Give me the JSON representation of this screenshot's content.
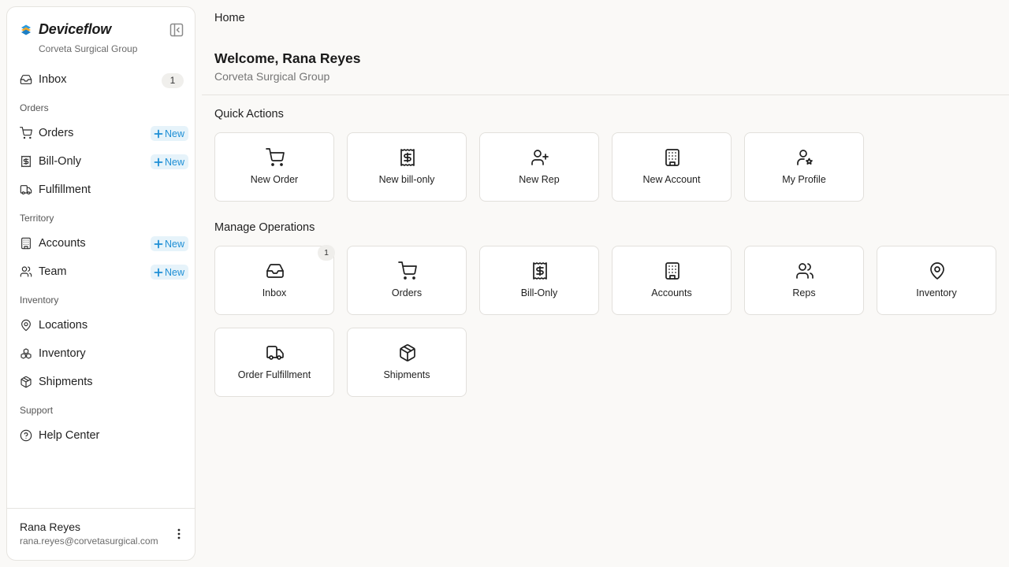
{
  "brand": {
    "name": "Deviceflow",
    "org": "Corveta Surgical Group"
  },
  "sidebar": {
    "inbox": {
      "label": "Inbox",
      "badge": "1"
    },
    "sections": {
      "orders": "Orders",
      "territory": "Territory",
      "inventory": "Inventory",
      "support": "Support"
    },
    "items": {
      "orders": "Orders",
      "bill_only": "Bill-Only",
      "fulfillment": "Fulfillment",
      "accounts": "Accounts",
      "team": "Team",
      "locations": "Locations",
      "inventory": "Inventory",
      "shipments": "Shipments",
      "help_center": "Help Center"
    },
    "new_label": "New"
  },
  "user": {
    "name": "Rana Reyes",
    "email": "rana.reyes@corvetasurgical.com"
  },
  "main": {
    "breadcrumb": "Home",
    "title": "Welcome, Rana Reyes",
    "subtitle": "Corveta Surgical Group",
    "quick_actions_title": "Quick Actions",
    "quick_actions": [
      {
        "label": "New Order",
        "icon": "cart-icon"
      },
      {
        "label": "New bill-only",
        "icon": "receipt-icon"
      },
      {
        "label": "New Rep",
        "icon": "user-plus-icon"
      },
      {
        "label": "New Account",
        "icon": "building-icon"
      },
      {
        "label": "My Profile",
        "icon": "user-star-icon"
      }
    ],
    "manage_title": "Manage Operations",
    "manage_operations": [
      {
        "label": "Inbox",
        "icon": "inbox-icon",
        "badge": "1"
      },
      {
        "label": "Orders",
        "icon": "cart-icon"
      },
      {
        "label": "Bill-Only",
        "icon": "receipt-icon"
      },
      {
        "label": "Accounts",
        "icon": "building-icon"
      },
      {
        "label": "Reps",
        "icon": "users-icon"
      },
      {
        "label": "Inventory",
        "icon": "map-pin-icon"
      },
      {
        "label": "Order Fulfillment",
        "icon": "truck-icon"
      },
      {
        "label": "Shipments",
        "icon": "package-icon"
      }
    ]
  }
}
